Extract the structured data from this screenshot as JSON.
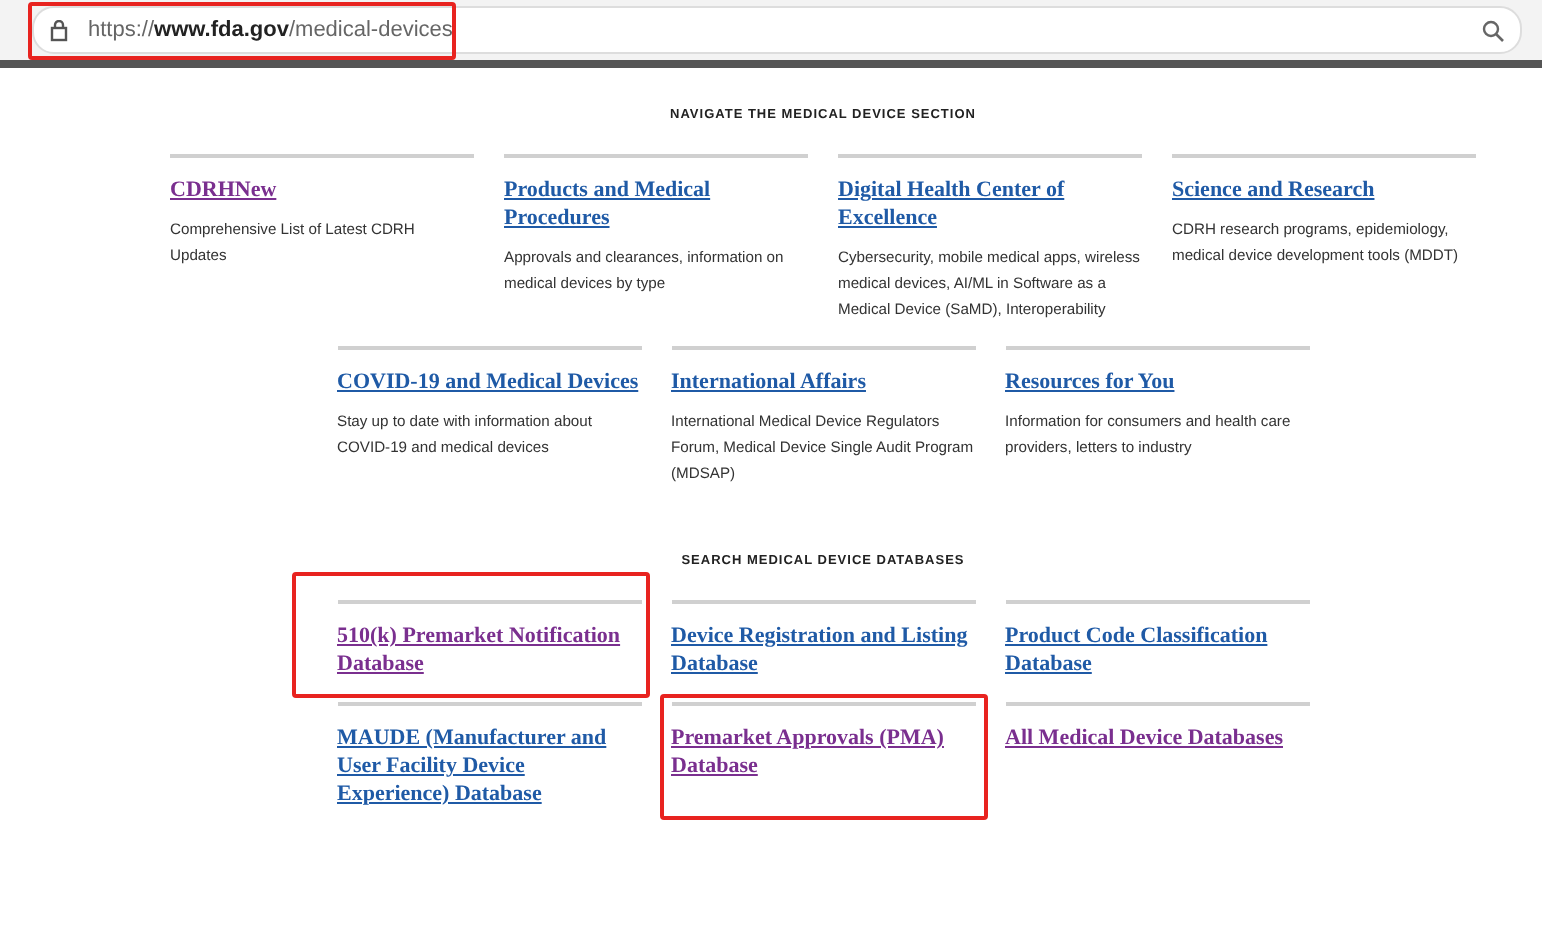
{
  "address_bar": {
    "url": "https://**www.fda.gov**/medical-devices",
    "highlighted": true
  },
  "sections": [
    {
      "heading": "NAVIGATE THE MEDICAL DEVICE SECTION",
      "rows": [
        [
          {
            "title": "CDRHNew",
            "visited": true,
            "highlighted": false,
            "description": "Comprehensive List of Latest CDRH Updates"
          },
          {
            "title": "Products and Medical Procedures",
            "visited": false,
            "highlighted": false,
            "description": "Approvals and clearances, information on medical devices by type"
          },
          {
            "title": "Digital Health Center of Excellence",
            "visited": false,
            "highlighted": false,
            "description": "Cybersecurity, mobile medical apps, wireless medical devices, AI/ML in Software as a Medical Device (SaMD), Interoperability"
          },
          {
            "title": "Science and Research",
            "visited": false,
            "highlighted": false,
            "description": "CDRH research programs, epidemiology, medical device development tools (MDDT)"
          }
        ],
        [
          {
            "title": "COVID-19 and Medical Devices",
            "visited": false,
            "highlighted": false,
            "description": "Stay up to date with information about COVID-19 and medical devices"
          },
          {
            "title": "International Affairs",
            "visited": false,
            "highlighted": false,
            "description": "International Medical Device Regulators Forum, Medical Device Single Audit Program (MDSAP)"
          },
          {
            "title": "Resources for You",
            "visited": false,
            "highlighted": false,
            "description": "Information for consumers and health care providers, letters to industry"
          }
        ]
      ]
    },
    {
      "heading": "SEARCH MEDICAL DEVICE DATABASES",
      "rows": [
        [
          {
            "title": "510(k) Premarket Notification Database",
            "visited": true,
            "highlighted": true
          },
          {
            "title": "Device Registration and Listing Database",
            "visited": false,
            "highlighted": false
          },
          {
            "title": "Product Code Classification Database",
            "visited": false,
            "highlighted": false
          }
        ],
        [
          {
            "title": "MAUDE (Manufacturer and User Facility Device Experience) Database",
            "visited": false,
            "highlighted": false
          },
          {
            "title": "Premarket Approvals (PMA) Database",
            "visited": true,
            "highlighted": true
          },
          {
            "title": "All Medical Device Databases",
            "visited": true,
            "highlighted": false
          }
        ]
      ]
    }
  ]
}
